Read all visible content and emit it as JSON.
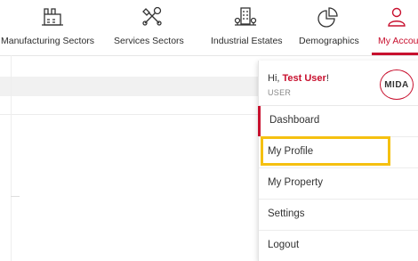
{
  "nav": {
    "items": [
      {
        "label": "Manufacturing Sectors",
        "icon": "factory-icon"
      },
      {
        "label": "Services Sectors",
        "icon": "tools-icon"
      },
      {
        "label": "Industrial Estates",
        "icon": "industrial-estate-icon"
      },
      {
        "label": "Demographics",
        "icon": "pie-chart-icon"
      },
      {
        "label": "My Accoun",
        "icon": "user-icon",
        "active": true
      }
    ]
  },
  "account_menu": {
    "greeting_prefix": "Hi, ",
    "user_name": "Test User",
    "greeting_suffix": "!",
    "role": "USER",
    "logo_text": "MIDA",
    "items": [
      {
        "label": "Dashboard"
      },
      {
        "label": "My Profile"
      },
      {
        "label": "My Property"
      },
      {
        "label": "Settings"
      },
      {
        "label": "Logout"
      }
    ]
  },
  "colors": {
    "accent": "#c8102e",
    "highlight": "#f5c010"
  }
}
